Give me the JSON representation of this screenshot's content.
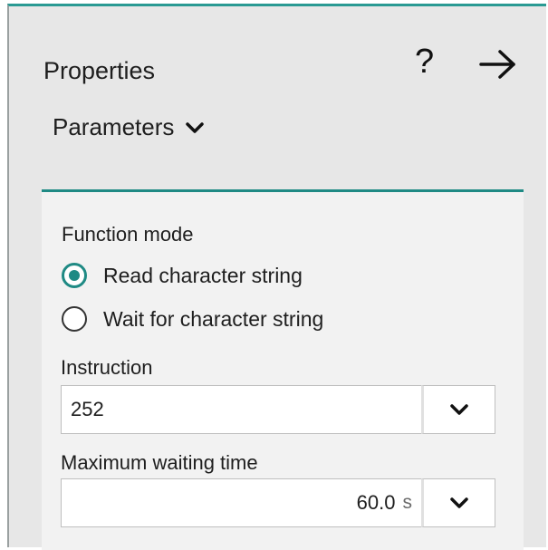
{
  "panel": {
    "title": "Properties",
    "help_glyph": "?",
    "section_title": "Parameters"
  },
  "function_mode": {
    "label": "Function mode",
    "options": [
      {
        "label": "Read character string",
        "selected": true
      },
      {
        "label": "Wait for character string",
        "selected": false
      }
    ]
  },
  "instruction": {
    "label": "Instruction",
    "value": "252"
  },
  "max_wait": {
    "label": "Maximum waiting time",
    "value": "60.0",
    "unit": "s"
  },
  "colors": {
    "accent": "#1f8a84",
    "panel_bg": "#e7e7e7",
    "card_bg": "#f2f2f2"
  },
  "icons": {
    "help": "question-mark-icon",
    "forward": "arrow-right-icon",
    "expand": "chevron-down-icon"
  }
}
